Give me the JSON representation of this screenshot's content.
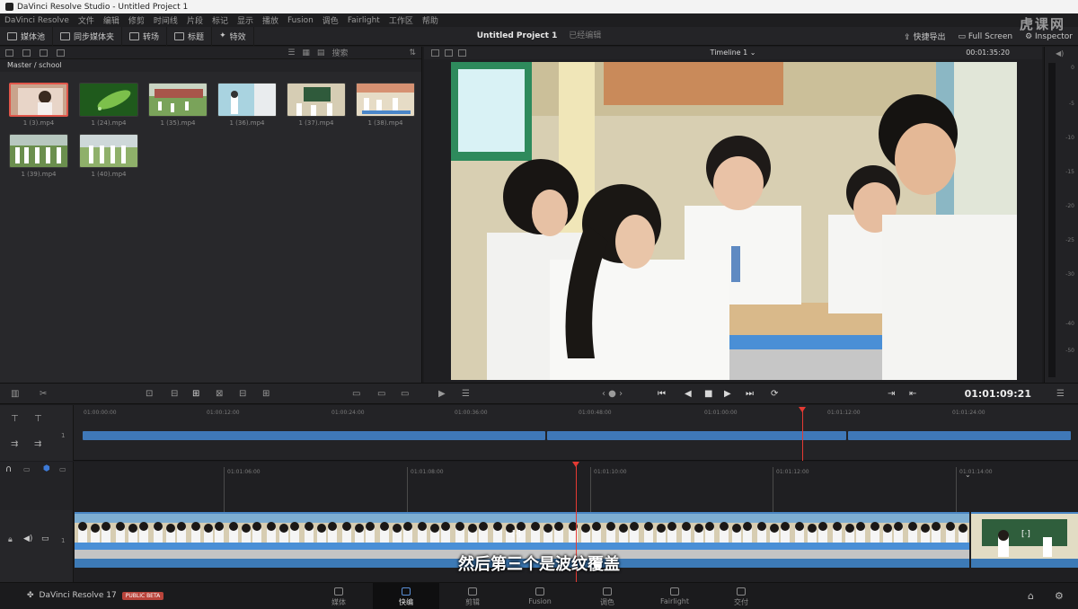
{
  "titlebar": {
    "title": "DaVinci Resolve Studio - Untitled Project 1"
  },
  "menu": [
    "DaVinci Resolve",
    "文件",
    "编辑",
    "修剪",
    "时间线",
    "片段",
    "标记",
    "显示",
    "播放",
    "Fusion",
    "调色",
    "Fairlight",
    "工作区",
    "帮助"
  ],
  "toolbar": {
    "media_pool": "媒体池",
    "sync_bin": "同步媒体夹",
    "transitions": "转场",
    "titles": "标题",
    "effects": "特效",
    "project_title": "Untitled Project 1",
    "project_sub": "已经编辑",
    "quick_export": "快捷导出",
    "full_screen": "Full Screen",
    "inspector": "Inspector"
  },
  "media_pool": {
    "search": "搜索",
    "path": "Master / school",
    "clips": [
      {
        "name": "1 (3).mp4"
      },
      {
        "name": "1 (24).mp4"
      },
      {
        "name": "1 (35).mp4"
      },
      {
        "name": "1 (36).mp4"
      },
      {
        "name": "1 (37).mp4"
      },
      {
        "name": "1 (38).mp4"
      },
      {
        "name": "1 (39).mp4"
      },
      {
        "name": "1 (40).mp4"
      }
    ]
  },
  "viewer": {
    "timeline_name": "Timeline 1",
    "duration_tc": "00:01:35:20",
    "current_tc": "01:01:09:21"
  },
  "meter_ticks": [
    "0",
    "-5",
    "-10",
    "-15",
    "-20",
    "-25",
    "-30",
    "-40",
    "-50"
  ],
  "upper_ruler": [
    "01:00:00:00",
    "01:00:12:00",
    "01:00:24:00",
    "01:00:36:00",
    "01:00:48:00",
    "01:01:00:00",
    "01:01:12:00",
    "01:01:24:00"
  ],
  "lower_ruler": [
    "01:01:06:00",
    "01:01:08:00",
    "01:01:10:00",
    "01:01:12:00",
    "01:01:14:00"
  ],
  "track_number": "1",
  "subtitle": "然后第三个是波纹覆盖",
  "pages": [
    "媒体",
    "快编",
    "剪辑",
    "Fusion",
    "调色",
    "Fairlight",
    "交付"
  ],
  "active_page": "快编",
  "brand": {
    "name": "DaVinci Resolve 17",
    "badge": "PUBLIC BETA"
  },
  "watermark": "虎课网",
  "colors": {
    "accent": "#e53a33",
    "clip_blue": "#3f78b8",
    "beta": "#b9443b"
  }
}
